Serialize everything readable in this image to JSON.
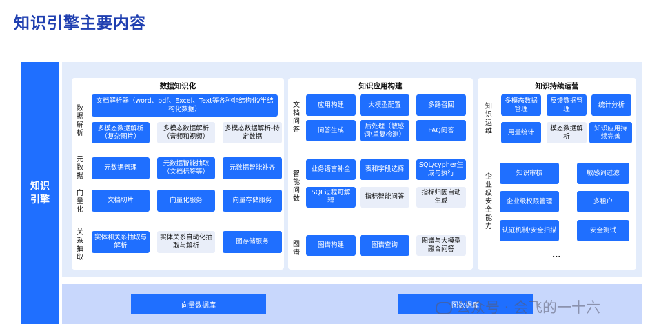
{
  "title": "知识引擎主要内容",
  "side_label": "知识引擎",
  "panel1": {
    "heading": "数据知识化",
    "groups": [
      {
        "label": "数据解析"
      },
      {
        "label": "元数据"
      },
      {
        "label": "向量化"
      },
      {
        "label": "关系抽取"
      }
    ],
    "doc_parser": "文档解析器（word、pdf、Excel、Text等各种非结构化/半结构化数据）",
    "mm_image": "多模态数据解析（复杂图片）",
    "mm_av": "多模态数据解析（音频和视频）",
    "mm_specific": "多模态数据解析-特定数据",
    "meta_manage": "元数据管理",
    "meta_extract": "元数据智能抽取（文档标签等）",
    "meta_fill": "元数据智能补齐",
    "doc_slice": "文档切片",
    "vec_service": "向量化服务",
    "vec_store": "向量存储服务",
    "entity_extract": "实体和关系抽取与解析",
    "entity_auto": "实体关系自动化抽取与解析",
    "graph_store": "图存储服务"
  },
  "panel2": {
    "heading": "知识应用构建",
    "groups": [
      {
        "label": "文档问答"
      },
      {
        "label": "智能问数"
      },
      {
        "label": "图谱"
      }
    ],
    "app_build": "应用构建",
    "model_config": "大模型配置",
    "multi_recall": "多路召回",
    "qa_gen": "问答生成",
    "post_process": "后处理（敏感词\\重复检测）",
    "faq": "FAQ问答",
    "biz_lang": "业务语言补全",
    "table_field": "表和字段选择",
    "sql_gen": "SQL/cypher生成与执行",
    "sql_explain": "SQL过程可解释",
    "metric_qa": "指标智能问答",
    "metric_attr": "指标归因自动生成",
    "graph_build": "图谱构建",
    "graph_query": "图谱查询",
    "graph_llm": "图谱与大模型融合问答"
  },
  "panel3": {
    "heading": "知识持续运营",
    "groups": [
      {
        "label": "知识运维"
      },
      {
        "label": "企业级安全能力"
      }
    ],
    "mm_manage": "多模态数据管理",
    "feedback": "反馈数据管理",
    "stats": "统计分析",
    "usage": "用量统计",
    "mm_parse": "模态数据解析",
    "app_improve": "知识应用持续完善",
    "review": "知识审核",
    "sensitive": "敏感词过滤",
    "perm": "企业级权限管理",
    "tenant": "多租户",
    "auth": "认证机制/安全扫描",
    "sec_test": "安全测试",
    "more": "..."
  },
  "storage": {
    "vector_db": "向量数据库",
    "graph_db": "图数据库"
  },
  "watermark": "公众号 · 会飞的一十六"
}
